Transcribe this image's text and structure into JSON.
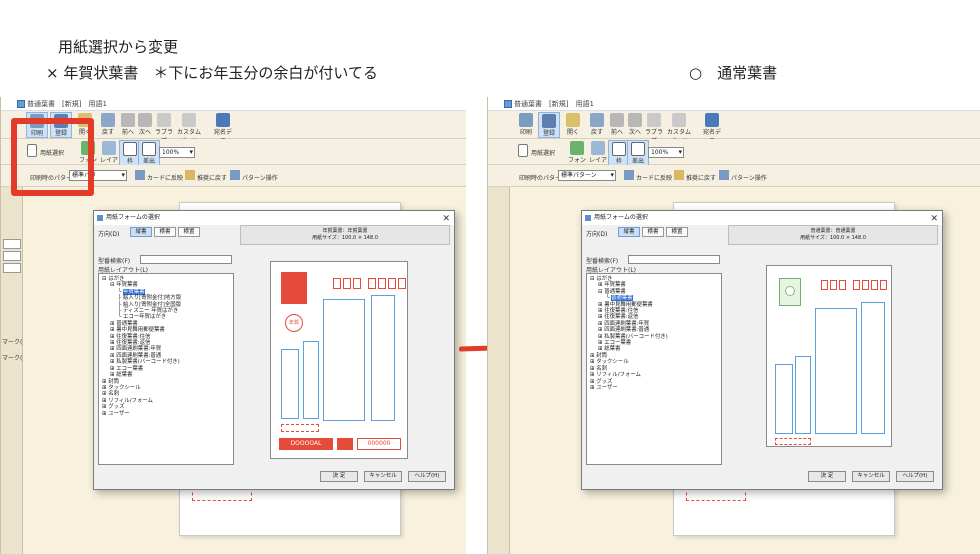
{
  "captions": {
    "left_line1": "用紙選択から変更",
    "left_line2": "× 年賀状葉書　＊下にお年玉分の余白が付いてる",
    "right_line1": "○　通常葉書"
  },
  "left": {
    "window_title": "普通葉書　[新規]　用語1",
    "toolbar1": [
      "印刷",
      "登録",
      "開く",
      "戻す",
      "前へ",
      "次へ",
      "ラブラブ",
      "カスタムパーツ",
      "宛名デコ"
    ],
    "toolbar2": [
      "用紙選択",
      "フォント",
      "レイアウト",
      "枠",
      "差出"
    ],
    "zoom": "100%",
    "pattern_label": "印刷時のパターン：",
    "pattern_value": "標準パタ",
    "toolbar3": [
      "カードに反映",
      "推奨に戻す",
      "パターン操作"
    ],
    "side_labels": [
      "マーク(",
      "マーク("
    ],
    "dialog": {
      "title": "用紙フォームの選択",
      "direction_label": "方向(D)",
      "dir_options": [
        "縦書",
        "横書",
        "横置"
      ],
      "info_line1": "年賀葉書：年賀葉書",
      "info_line2": "用紙サイズ：100.0 × 148.0",
      "search_label": "型番検索(F)",
      "tree_label": "用紙レイアウト(L)",
      "tree": [
        "はがき",
        "年賀葉書",
        "年賀葉書",
        "絵入り[寄附金付]地方版",
        "絵入り[寄附金付]全国版",
        "ディズニー 年賀はがき",
        "エコー年賀はがき",
        "普通葉書",
        "暑中見舞用郵便葉書",
        "往復葉書:往信",
        "往復葉書:返信",
        "四面連刷葉書:年賀",
        "四面連刷葉書:普通",
        "私製葉書(バーコード付き)",
        "エコー葉書",
        "総葉書",
        "封筒",
        "タックシール",
        "名刺",
        "リフィル/フォーム",
        "グッズ",
        "ユーザー"
      ],
      "selected_index": 2,
      "stamp_text": "年賀",
      "lottery_left": "DOOOOAL",
      "lottery_right": "000000",
      "buttons": [
        "決 定",
        "キャンセル",
        "ヘルプ(H)"
      ]
    }
  },
  "right": {
    "window_title": "普通葉書　[新規]　用語1",
    "toolbar1": [
      "印刷",
      "登録",
      "開く",
      "戻す",
      "前へ",
      "次へ",
      "ラブラブ",
      "カスタムパーツ",
      "宛名デコ"
    ],
    "toolbar2": [
      "用紙選択",
      "フォント",
      "レイアウト",
      "枠",
      "差出"
    ],
    "zoom": "100%",
    "pattern_label": "印刷時のパターン：",
    "pattern_value": "標準パターン",
    "toolbar3": [
      "カードに反映",
      "推奨に戻す",
      "パターン操作"
    ],
    "dialog": {
      "title": "用紙フォームの選択",
      "direction_label": "方向(D)",
      "dir_options": [
        "縦書",
        "横書",
        "横置"
      ],
      "info_line1": "普通葉書：普通葉書",
      "info_line2": "用紙サイズ：100.0 × 148.0",
      "search_label": "型番検索(F)",
      "tree_label": "用紙レイアウト(L)",
      "tree": [
        "はがき",
        "年賀葉書",
        "普通葉書",
        "普通葉書",
        "暑中見舞用郵便葉書",
        "往復葉書:往信",
        "往復葉書:返信",
        "四面連刷葉書:年賀",
        "四面連刷葉書:普通",
        "私製葉書(バーコード付き)",
        "エコー葉書",
        "総葉書",
        "封筒",
        "タックシール",
        "名刺",
        "リフィル/フォーム",
        "グッズ",
        "ユーザー"
      ],
      "selected_index": 3,
      "buttons": [
        "決 定",
        "キャンセル",
        "ヘルプ(H)"
      ]
    }
  },
  "colors": {
    "highlight_red": "#e23b2a",
    "postal_red": "#e54b3b",
    "address_blue": "#5aa0dc",
    "selection_blue": "#2e6fd0",
    "window_cream": "#f7f1dd"
  }
}
